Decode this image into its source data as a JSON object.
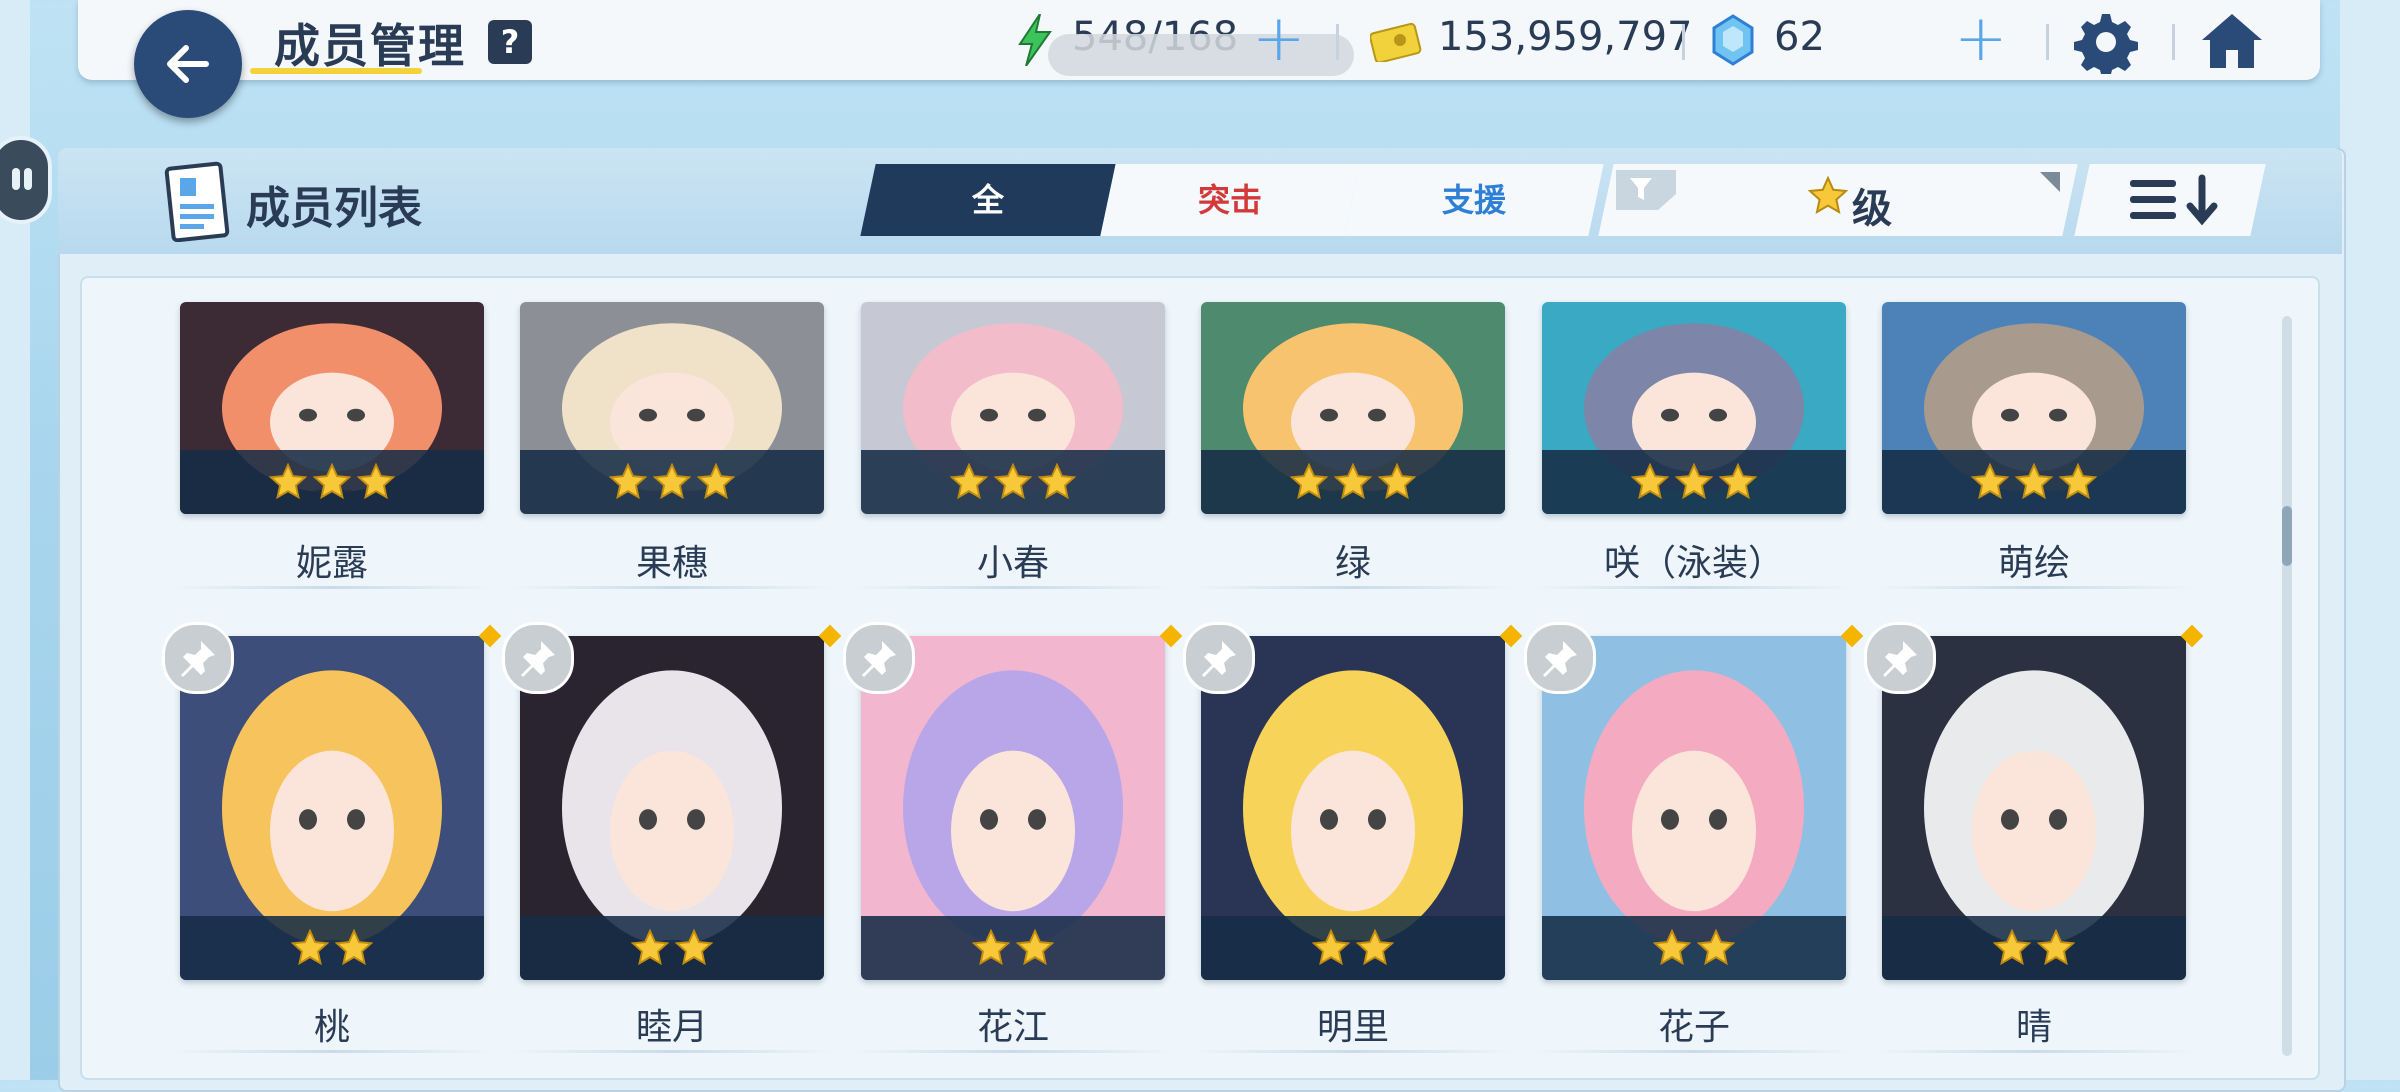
{
  "header": {
    "title": "成员管理",
    "help_label": "?",
    "energy": "548/168",
    "credits": "153,959,797",
    "gems": "62",
    "back_icon": "arrow-left-icon",
    "settings_icon": "gear-icon",
    "home_icon": "home-icon"
  },
  "list": {
    "title": "成员列表",
    "tabs": [
      {
        "label": "全",
        "active": true
      },
      {
        "label": "突击",
        "color": "#d23a3a"
      },
      {
        "label": "支援",
        "color": "#2f7fd6"
      }
    ],
    "sort_label": "级",
    "sort_icon": "star-icon",
    "filter_icon": "funnel-icon",
    "order_icon": "sort-descending-icon"
  },
  "members_row1": [
    {
      "name": "妮露",
      "stars": 3,
      "colors": [
        "#f28f6b",
        "#3c2a35"
      ]
    },
    {
      "name": "果穗",
      "stars": 3,
      "colors": [
        "#efe2c9",
        "#8c8f96"
      ]
    },
    {
      "name": "小春",
      "stars": 3,
      "colors": [
        "#f2bccb",
        "#c6c9d3"
      ]
    },
    {
      "name": "绿",
      "stars": 3,
      "colors": [
        "#f7c36f",
        "#4e8a6e"
      ]
    },
    {
      "name": "咲（泳装）",
      "stars": 3,
      "colors": [
        "#7d86a8",
        "#3aa9c4"
      ]
    },
    {
      "name": "萌绘",
      "stars": 3,
      "colors": [
        "#a89a8c",
        "#4d82b8"
      ]
    }
  ],
  "members_row2": [
    {
      "name": "桃",
      "stars": 2,
      "colors": [
        "#f7c35c",
        "#3d4e7a"
      ]
    },
    {
      "name": "睦月",
      "stars": 2,
      "colors": [
        "#e9e4ea",
        "#2a2430"
      ]
    },
    {
      "name": "花江",
      "stars": 2,
      "colors": [
        "#b8a6e8",
        "#f2b6cf"
      ]
    },
    {
      "name": "明里",
      "stars": 2,
      "colors": [
        "#f7d35a",
        "#2a3454"
      ]
    },
    {
      "name": "花子",
      "stars": 2,
      "colors": [
        "#f4aac0",
        "#8fc0e4"
      ]
    },
    {
      "name": "晴",
      "stars": 2,
      "colors": [
        "#e8eaec",
        "#2b3140"
      ]
    }
  ]
}
